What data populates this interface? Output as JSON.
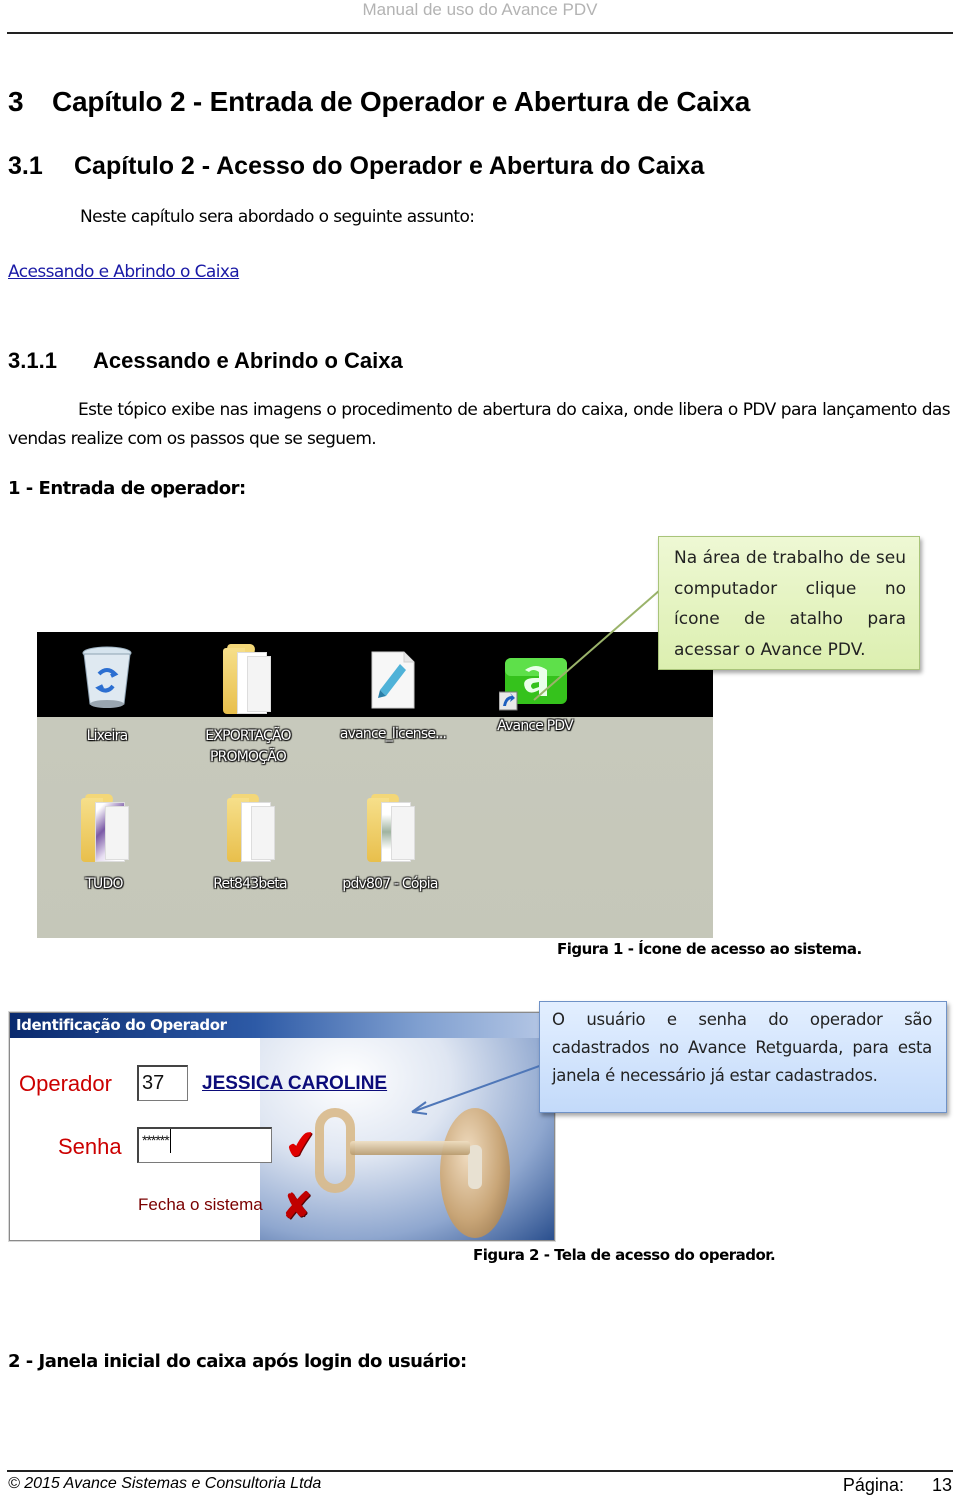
{
  "header": {
    "running_title": "Manual de uso do Avance PDV"
  },
  "chapter": {
    "number": "3",
    "title": "Capítulo 2 - Entrada de Operador e Abertura de Caixa"
  },
  "section": {
    "number": "3.1",
    "title": "Capítulo 2 - Acesso do Operador e Abertura do Caixa"
  },
  "intro_text": "Neste capítulo sera abordado o seguinte assunto:",
  "toc_link": "Acessando e Abrindo o Caixa",
  "subsection": {
    "number": "3.1.1",
    "title": "Acessando e Abrindo o Caixa"
  },
  "body_text": "Este tópico exibe nas imagens o procedimento de abertura do caixa, onde libera o PDV para lançamento das vendas realize com os passos que se seguem.",
  "step1": "1 - Entrada de operador:",
  "figure1": {
    "desktop_icons": [
      {
        "label": "Lixeira",
        "icon": "recycle-bin-icon"
      },
      {
        "label": "EXPORTAÇÃO PROMOÇÃO",
        "icon": "folder-icon"
      },
      {
        "label": "avance_license...",
        "icon": "text-file-icon"
      },
      {
        "label": "Avance PDV",
        "icon": "avance-pdv-shortcut-icon"
      },
      {
        "label": "TUDO",
        "icon": "folder-icon"
      },
      {
        "label": "Ret843beta",
        "icon": "folder-icon"
      },
      {
        "label": "pdv807 - Cópia",
        "icon": "folder-icon"
      }
    ],
    "callout": "Na área de trabalho de seu computador clique no ícone de atalho para acessar o Avance PDV.",
    "caption": "Figura 1 - Ícone de acesso ao sistema."
  },
  "figure2": {
    "window_title": "Identificação do Operador",
    "operator_label": "Operador",
    "operator_code": "37",
    "operator_name": "JESSICA CAROLINE",
    "password_label": "Senha",
    "password_value": "******",
    "close_label": "Fecha o sistema",
    "callout": "O usuário e senha do operador são cadastrados no Avance Retguarda, para esta janela é necessário já estar cadastrados.",
    "caption": "Figura 2 - Tela de acesso do operador."
  },
  "step2": "2 - Janela inicial do caixa após login do usuário:",
  "footer": {
    "copyright": "© 2015 Avance Sistemas e Consultoria Ltda",
    "page_label": "Página:",
    "page_number": "13"
  }
}
